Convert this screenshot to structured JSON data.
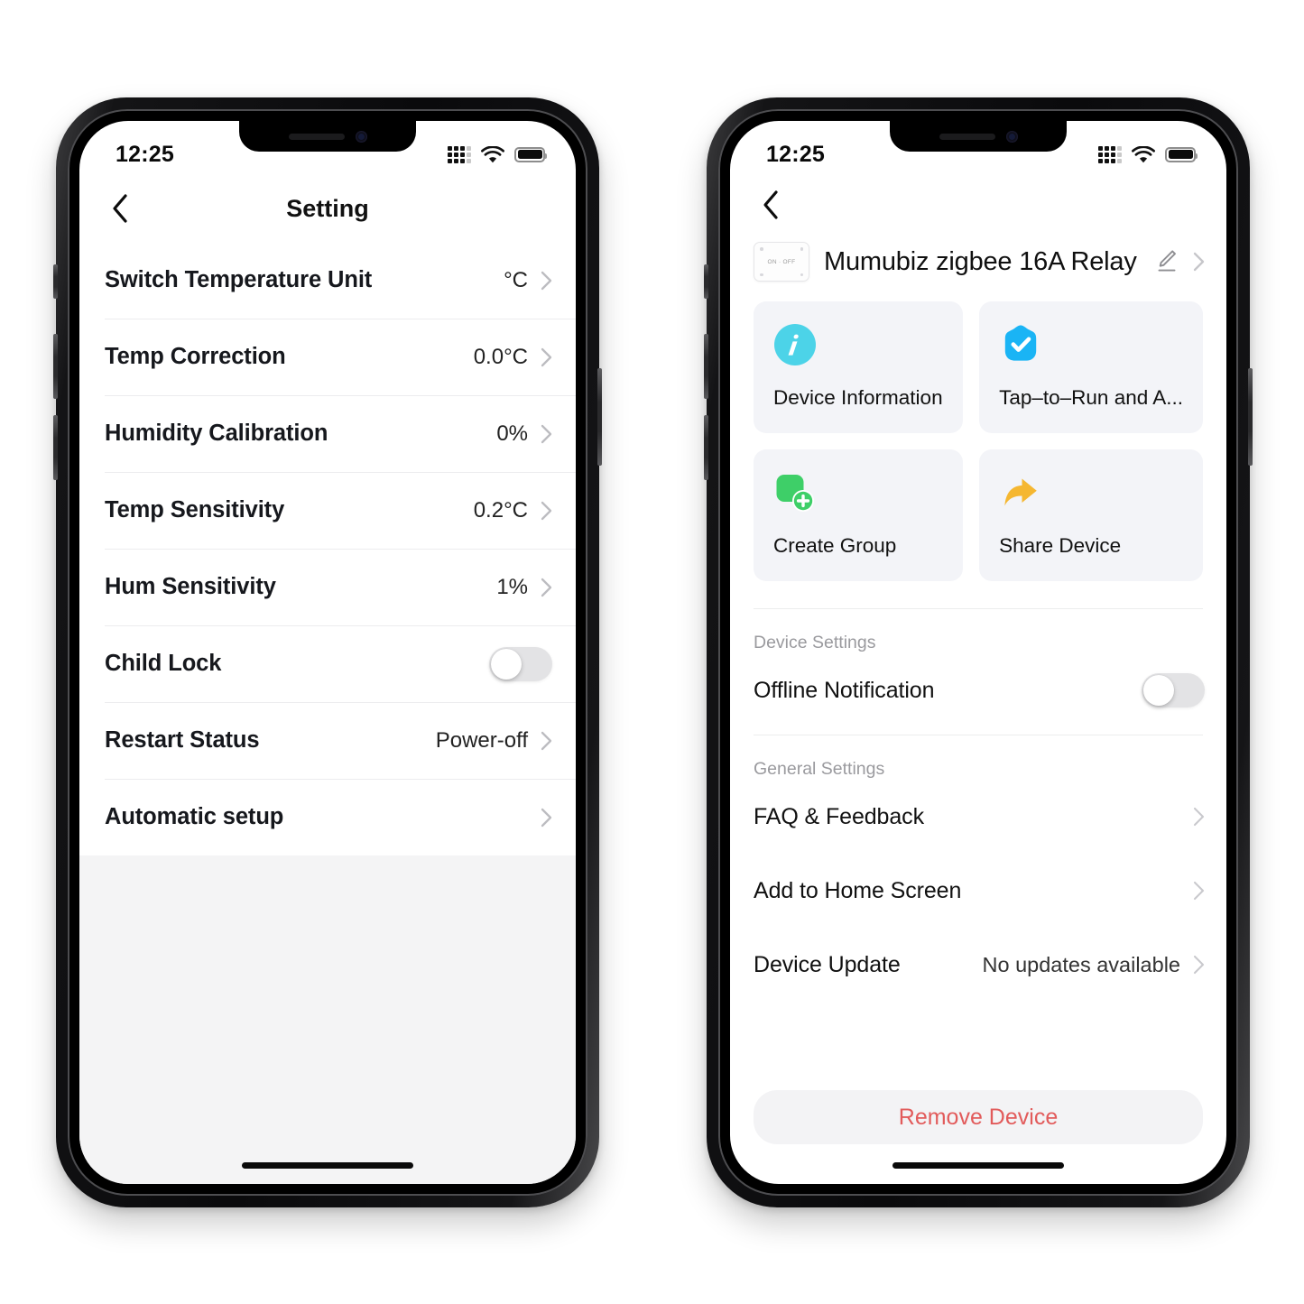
{
  "left_phone": {
    "status_bar": {
      "time": "12:25",
      "cellular": "cellular-dots-icon",
      "wifi": "wifi-icon",
      "battery": "battery-full-icon"
    },
    "nav": {
      "back": "chevron-left-icon",
      "title": "Setting"
    },
    "rows": [
      {
        "label": "Switch Temperature Unit",
        "value": "°C",
        "type": "chevron"
      },
      {
        "label": "Temp Correction",
        "value": "0.0°C",
        "type": "chevron"
      },
      {
        "label": "Humidity Calibration",
        "value": "0%",
        "type": "chevron"
      },
      {
        "label": "Temp Sensitivity",
        "value": "0.2°C",
        "type": "chevron"
      },
      {
        "label": "Hum Sensitivity",
        "value": "1%",
        "type": "chevron"
      },
      {
        "label": "Child Lock",
        "value": "",
        "type": "toggle",
        "toggle_on": false
      },
      {
        "label": "Restart Status",
        "value": "Power-off",
        "type": "chevron"
      },
      {
        "label": "Automatic setup",
        "value": "",
        "type": "chevron"
      }
    ]
  },
  "right_phone": {
    "status_bar": {
      "time": "12:25",
      "cellular": "cellular-dots-icon",
      "wifi": "wifi-icon",
      "battery": "battery-full-icon"
    },
    "nav": {
      "back": "chevron-left-icon"
    },
    "device": {
      "name": "Mumubiz zigbee 16A Relay",
      "thumb_label": "ON · OFF",
      "edit_icon": "pencil-icon",
      "chevron": "chevron-right-icon"
    },
    "cards": [
      {
        "label": "Device Information",
        "icon": "info-circle-icon",
        "color": "#4cd3e8"
      },
      {
        "label": "Tap–to–Run and A...",
        "icon": "shield-check-icon",
        "color": "#1ab4f5"
      },
      {
        "label": "Create Group",
        "icon": "group-plus-icon",
        "color": "#3ecf68"
      },
      {
        "label": "Share Device",
        "icon": "share-arrow-icon",
        "color": "#f5b731"
      }
    ],
    "device_settings": {
      "title": "Device Settings",
      "rows": [
        {
          "label": "Offline Notification",
          "value": "",
          "type": "toggle",
          "toggle_on": false
        }
      ]
    },
    "general_settings": {
      "title": "General Settings",
      "rows": [
        {
          "label": "FAQ & Feedback",
          "value": "",
          "type": "chevron"
        },
        {
          "label": "Add to Home Screen",
          "value": "",
          "type": "chevron"
        },
        {
          "label": "Device Update",
          "value": "No updates available",
          "type": "chevron"
        }
      ]
    },
    "remove_button": {
      "label": "Remove Device",
      "color": "#e25b5b"
    }
  }
}
